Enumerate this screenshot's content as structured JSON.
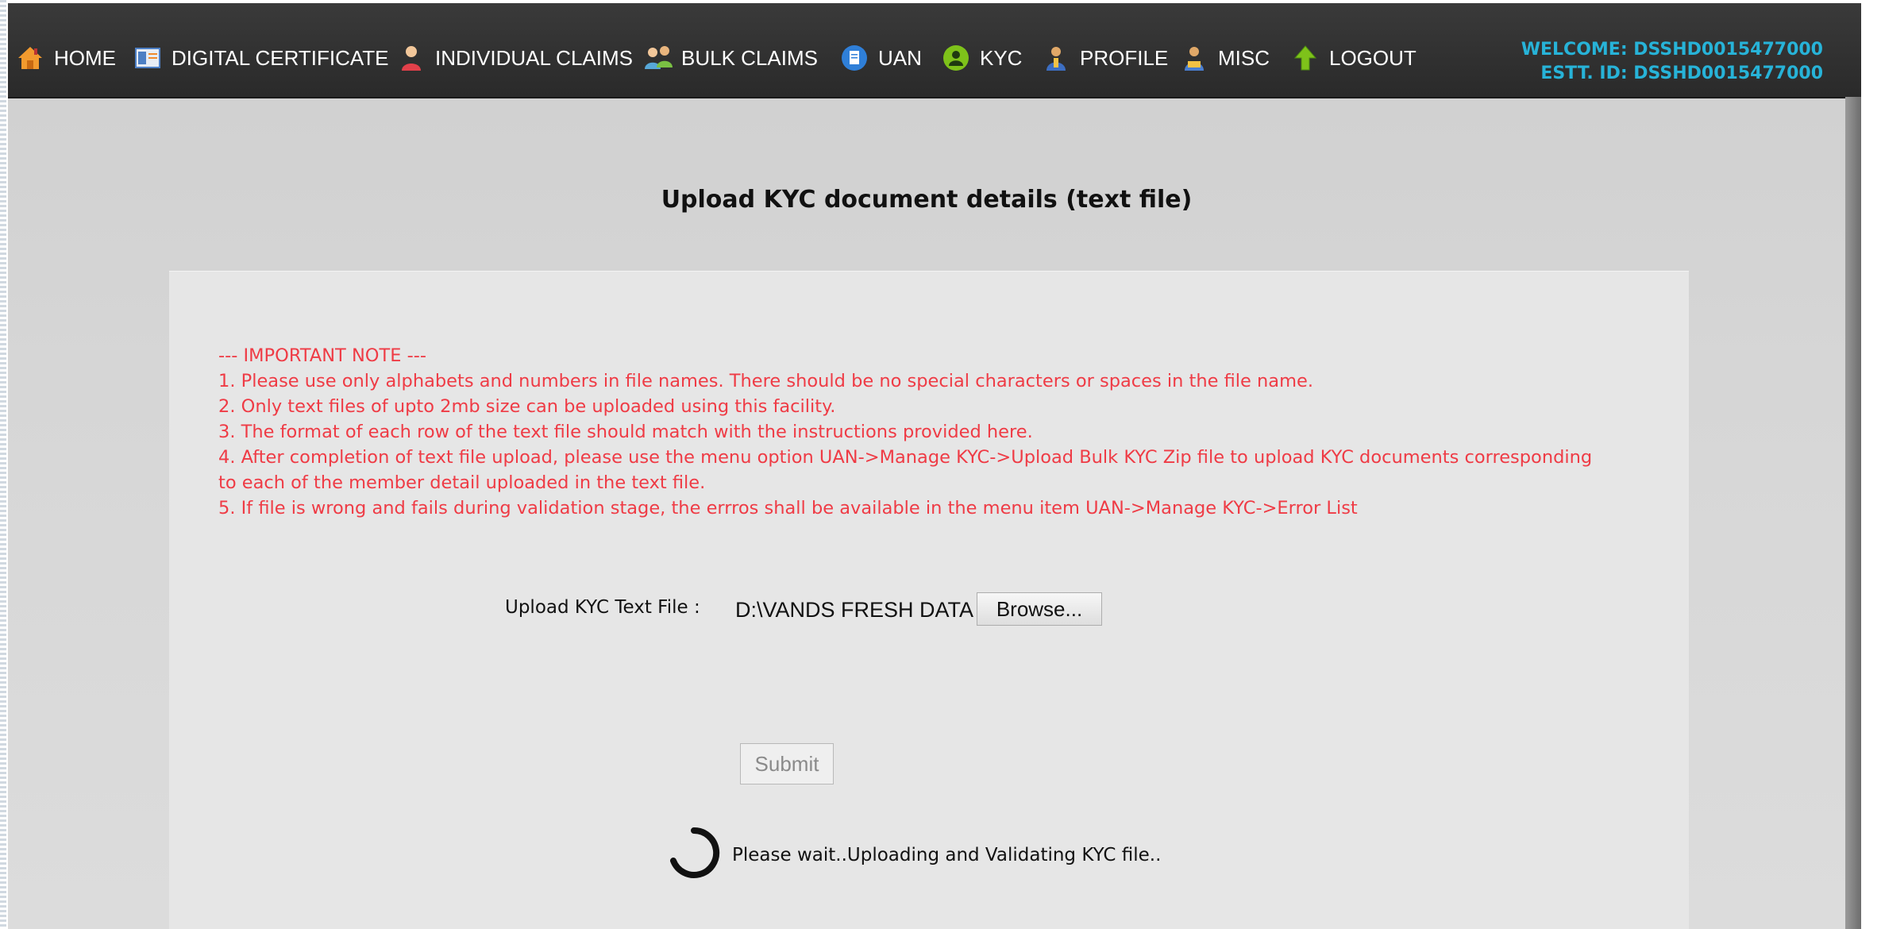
{
  "navbar": {
    "items": [
      {
        "label": "HOME",
        "icon": "home-icon"
      },
      {
        "label": "DIGITAL CERTIFICATE",
        "icon": "certificate-icon"
      },
      {
        "label": "INDIVIDUAL CLAIMS",
        "icon": "person-icon"
      },
      {
        "label": "BULK CLAIMS",
        "icon": "people-icon"
      },
      {
        "label": "UAN",
        "icon": "document-icon"
      },
      {
        "label": "KYC",
        "icon": "user-circle-icon"
      },
      {
        "label": "PROFILE",
        "icon": "profile-icon"
      },
      {
        "label": "MISC",
        "icon": "misc-icon"
      },
      {
        "label": "LOGOUT",
        "icon": "arrow-up-icon"
      }
    ],
    "welcome": "WELCOME: DSSHD0015477000",
    "estt_id": "ESTT. ID: DSSHD0015477000"
  },
  "page": {
    "title": "Upload KYC document details (text file)"
  },
  "note": {
    "header": "--- IMPORTANT NOTE ---",
    "lines": [
      "1. Please use only alphabets and numbers in file names. There should be no special characters or spaces in the file name.",
      "2. Only text files of upto 2mb size can be uploaded using this facility.",
      "3. The format of each row of the text file should match with the instructions provided here.",
      "4. After completion of text file upload, please use the menu option UAN->Manage KYC->Upload Bulk KYC Zip file to upload KYC documents corresponding",
      "to each of the member detail uploaded in the text file.",
      "5. If file is wrong and fails during validation stage, the errros shall be available in the menu item UAN->Manage KYC->Error List"
    ]
  },
  "form": {
    "upload_label": "Upload KYC Text File :",
    "file_value": "D:\\VANDS FRESH DATA",
    "browse_label": "Browse...",
    "submit_label": "Submit",
    "wait_message": "Please wait..Uploading and Validating KYC file.."
  },
  "colors": {
    "navbar_bg": "#2f2f2f",
    "welcome_text": "#27b3d8",
    "note_text": "#ef3b45",
    "page_bg": "#d6d6d6",
    "panel_bg": "#e6e6e6"
  }
}
